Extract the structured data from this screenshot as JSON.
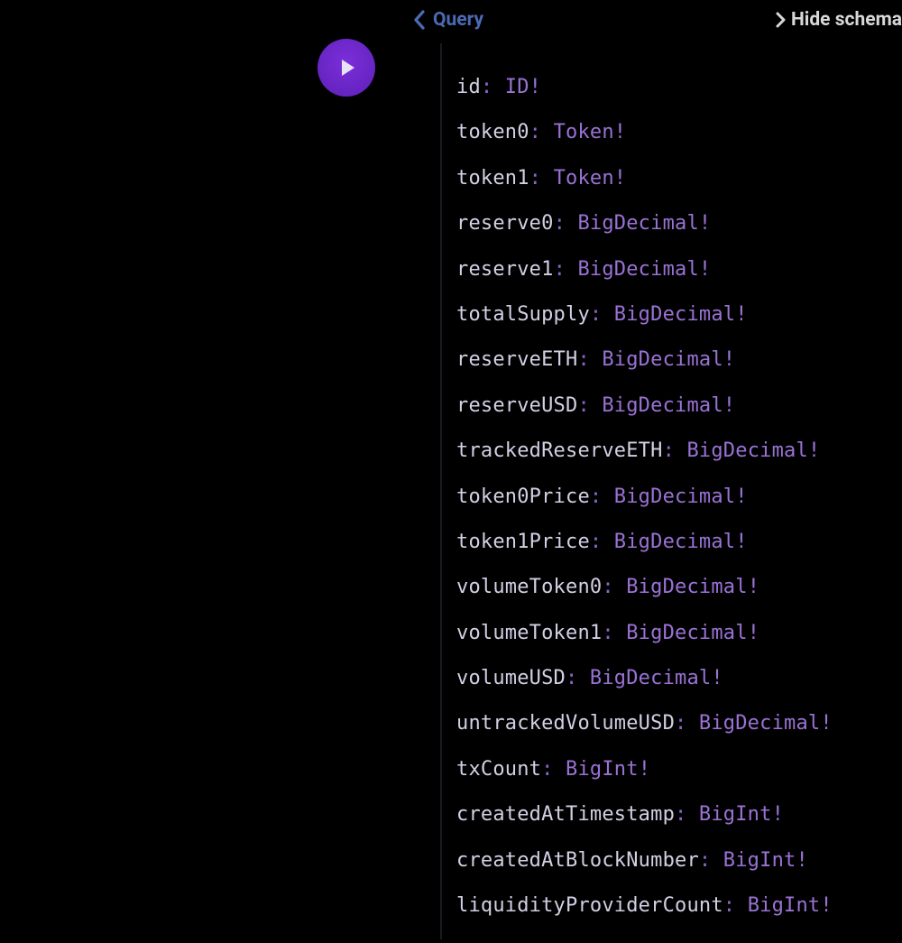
{
  "header": {
    "back_label": "Query",
    "hide_schema_label": "Hide schema"
  },
  "schema": {
    "fields": [
      {
        "name": "id",
        "type": "ID",
        "nonNull": true
      },
      {
        "name": "token0",
        "type": "Token",
        "nonNull": true
      },
      {
        "name": "token1",
        "type": "Token",
        "nonNull": true
      },
      {
        "name": "reserve0",
        "type": "BigDecimal",
        "nonNull": true
      },
      {
        "name": "reserve1",
        "type": "BigDecimal",
        "nonNull": true
      },
      {
        "name": "totalSupply",
        "type": "BigDecimal",
        "nonNull": true
      },
      {
        "name": "reserveETH",
        "type": "BigDecimal",
        "nonNull": true
      },
      {
        "name": "reserveUSD",
        "type": "BigDecimal",
        "nonNull": true
      },
      {
        "name": "trackedReserveETH",
        "type": "BigDecimal",
        "nonNull": true
      },
      {
        "name": "token0Price",
        "type": "BigDecimal",
        "nonNull": true
      },
      {
        "name": "token1Price",
        "type": "BigDecimal",
        "nonNull": true
      },
      {
        "name": "volumeToken0",
        "type": "BigDecimal",
        "nonNull": true
      },
      {
        "name": "volumeToken1",
        "type": "BigDecimal",
        "nonNull": true
      },
      {
        "name": "volumeUSD",
        "type": "BigDecimal",
        "nonNull": true
      },
      {
        "name": "untrackedVolumeUSD",
        "type": "BigDecimal",
        "nonNull": true
      },
      {
        "name": "txCount",
        "type": "BigInt",
        "nonNull": true
      },
      {
        "name": "createdAtTimestamp",
        "type": "BigInt",
        "nonNull": true
      },
      {
        "name": "createdAtBlockNumber",
        "type": "BigInt",
        "nonNull": true
      },
      {
        "name": "liquidityProviderCount",
        "type": "BigInt",
        "nonNull": true
      }
    ]
  },
  "colors": {
    "accent_purple": "#6b21d0",
    "type_purple": "#9a72d4",
    "name_lilac": "#d4cfe4",
    "header_blue": "#4c6ab3"
  }
}
